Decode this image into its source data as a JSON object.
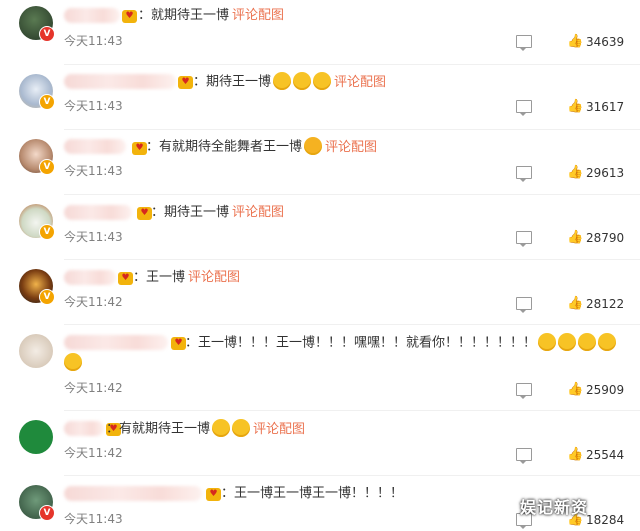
{
  "comments": [
    {
      "text": "：就期待王一博",
      "emojis": [],
      "link": "评论配图",
      "time": "今天11:43",
      "likes": "34639"
    },
    {
      "text": "：期待王一博",
      "emojis": [
        "tear-laugh-emoji",
        "tear-laugh-emoji",
        "tear-laugh-emoji"
      ],
      "link": "评论配图",
      "time": "今天11:43",
      "likes": "31617"
    },
    {
      "text": "：有就期待全能舞者王一博",
      "emojis": [
        "party-emoji"
      ],
      "link": "评论配图",
      "time": "今天11:43",
      "likes": "29613"
    },
    {
      "text": "：期待王一博",
      "emojis": [],
      "link": "评论配图",
      "time": "今天11:43",
      "likes": "28790"
    },
    {
      "text": "：王一博",
      "emojis": [],
      "link": "评论配图",
      "time": "今天11:42",
      "likes": "28122"
    },
    {
      "text": "：王一博！！！王一博！！！嘿嘿！！就看你！！！！！！！",
      "emojis": [
        "scream-emoji",
        "scream-emoji",
        "scream-emoji",
        "scream-emoji"
      ],
      "line2_emojis": [
        "scream-emoji"
      ],
      "link": "",
      "time": "今天11:42",
      "likes": "25909"
    },
    {
      "text": "：有就期待王一博",
      "emojis": [
        "heart-eyes-emoji",
        "heart-eyes-emoji"
      ],
      "link": "评论配图",
      "time": "今天11:42",
      "likes": "25544"
    },
    {
      "text": "：王一博王一博王一博！！！！",
      "emojis": [],
      "link": "",
      "time": "今天11:43",
      "likes": "18284"
    }
  ],
  "watermark": "娱记新资",
  "colors": {
    "link": "#eb7350",
    "time": "#808080",
    "badge": "#f4a400"
  }
}
